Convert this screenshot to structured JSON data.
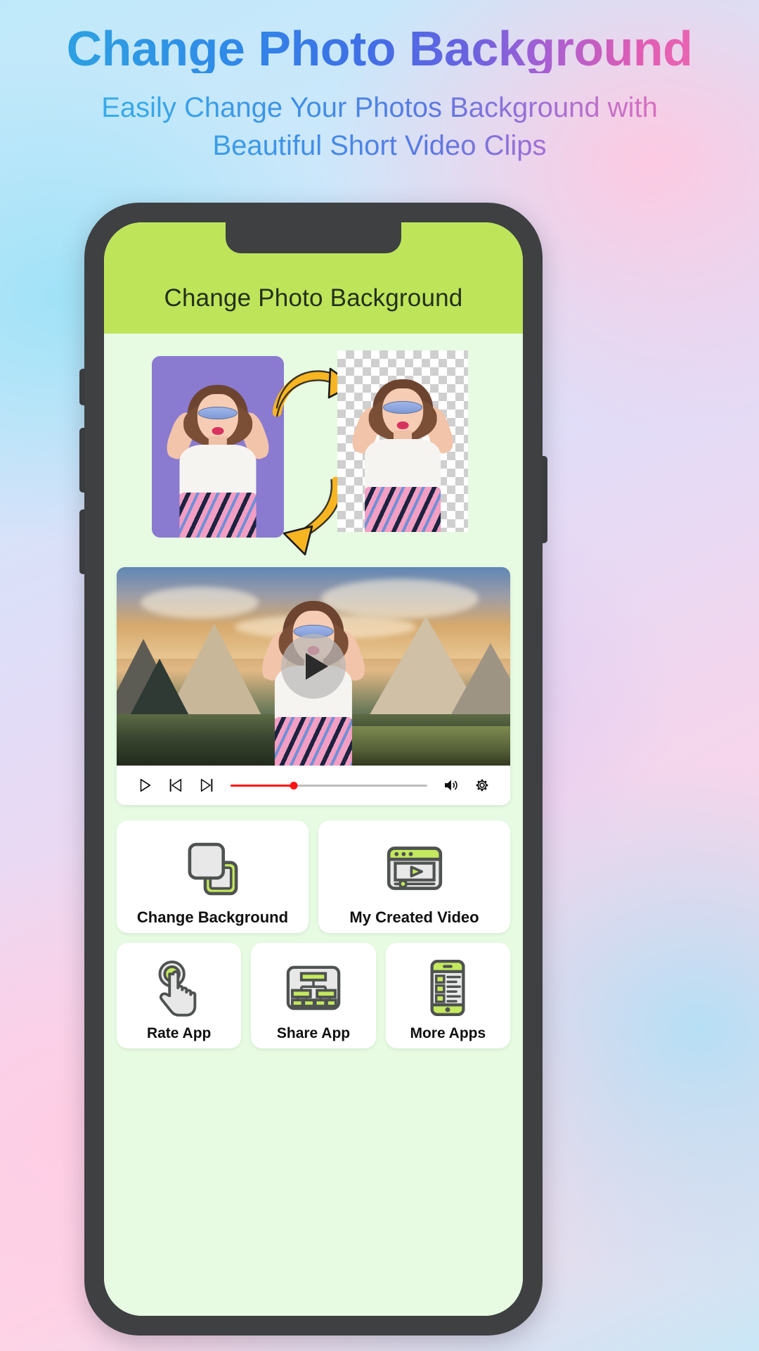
{
  "hero": {
    "title": "Change Photo Background",
    "subtitle_line1": "Easily Change Your Photos Background with",
    "subtitle_line2": "Beautiful Short Video Clips"
  },
  "app": {
    "appbar_title": "Change Photo Background",
    "accent_green": "#bee55a",
    "screen_bg": "#e6fbe2",
    "phone_frame": "#3e4042"
  },
  "demo": {
    "original_photo_alt": "woman-on-purple-background",
    "cutout_photo_alt": "woman-on-transparent-checkerboard",
    "arrow1": "curved-arrow-right",
    "arrow2": "curved-arrow-down",
    "arrow_color": "#f7b521"
  },
  "player": {
    "preview_alt": "woman-over-mountain-video-background",
    "play_overlay_icon": "play-icon",
    "controls": [
      {
        "name": "play-button",
        "icon": "play-icon"
      },
      {
        "name": "previous-button",
        "icon": "skip-previous-icon"
      },
      {
        "name": "next-button",
        "icon": "skip-next-icon"
      },
      {
        "name": "volume-button",
        "icon": "volume-icon"
      },
      {
        "name": "settings-button",
        "icon": "gear-icon"
      }
    ],
    "progress_percent": 32,
    "progress_color": "#ff1414",
    "track_color": "#bdbdbd"
  },
  "features": {
    "row1": [
      {
        "label": "Change Background",
        "icon": "two-overlapping-squares-icon"
      },
      {
        "label": "My Created Video",
        "icon": "video-window-play-icon"
      }
    ],
    "row2": [
      {
        "label": "Rate App",
        "icon": "hand-tap-icon"
      },
      {
        "label": "Share App",
        "icon": "share-network-icon"
      },
      {
        "label": "More Apps",
        "icon": "mobile-apps-list-icon"
      }
    ]
  }
}
